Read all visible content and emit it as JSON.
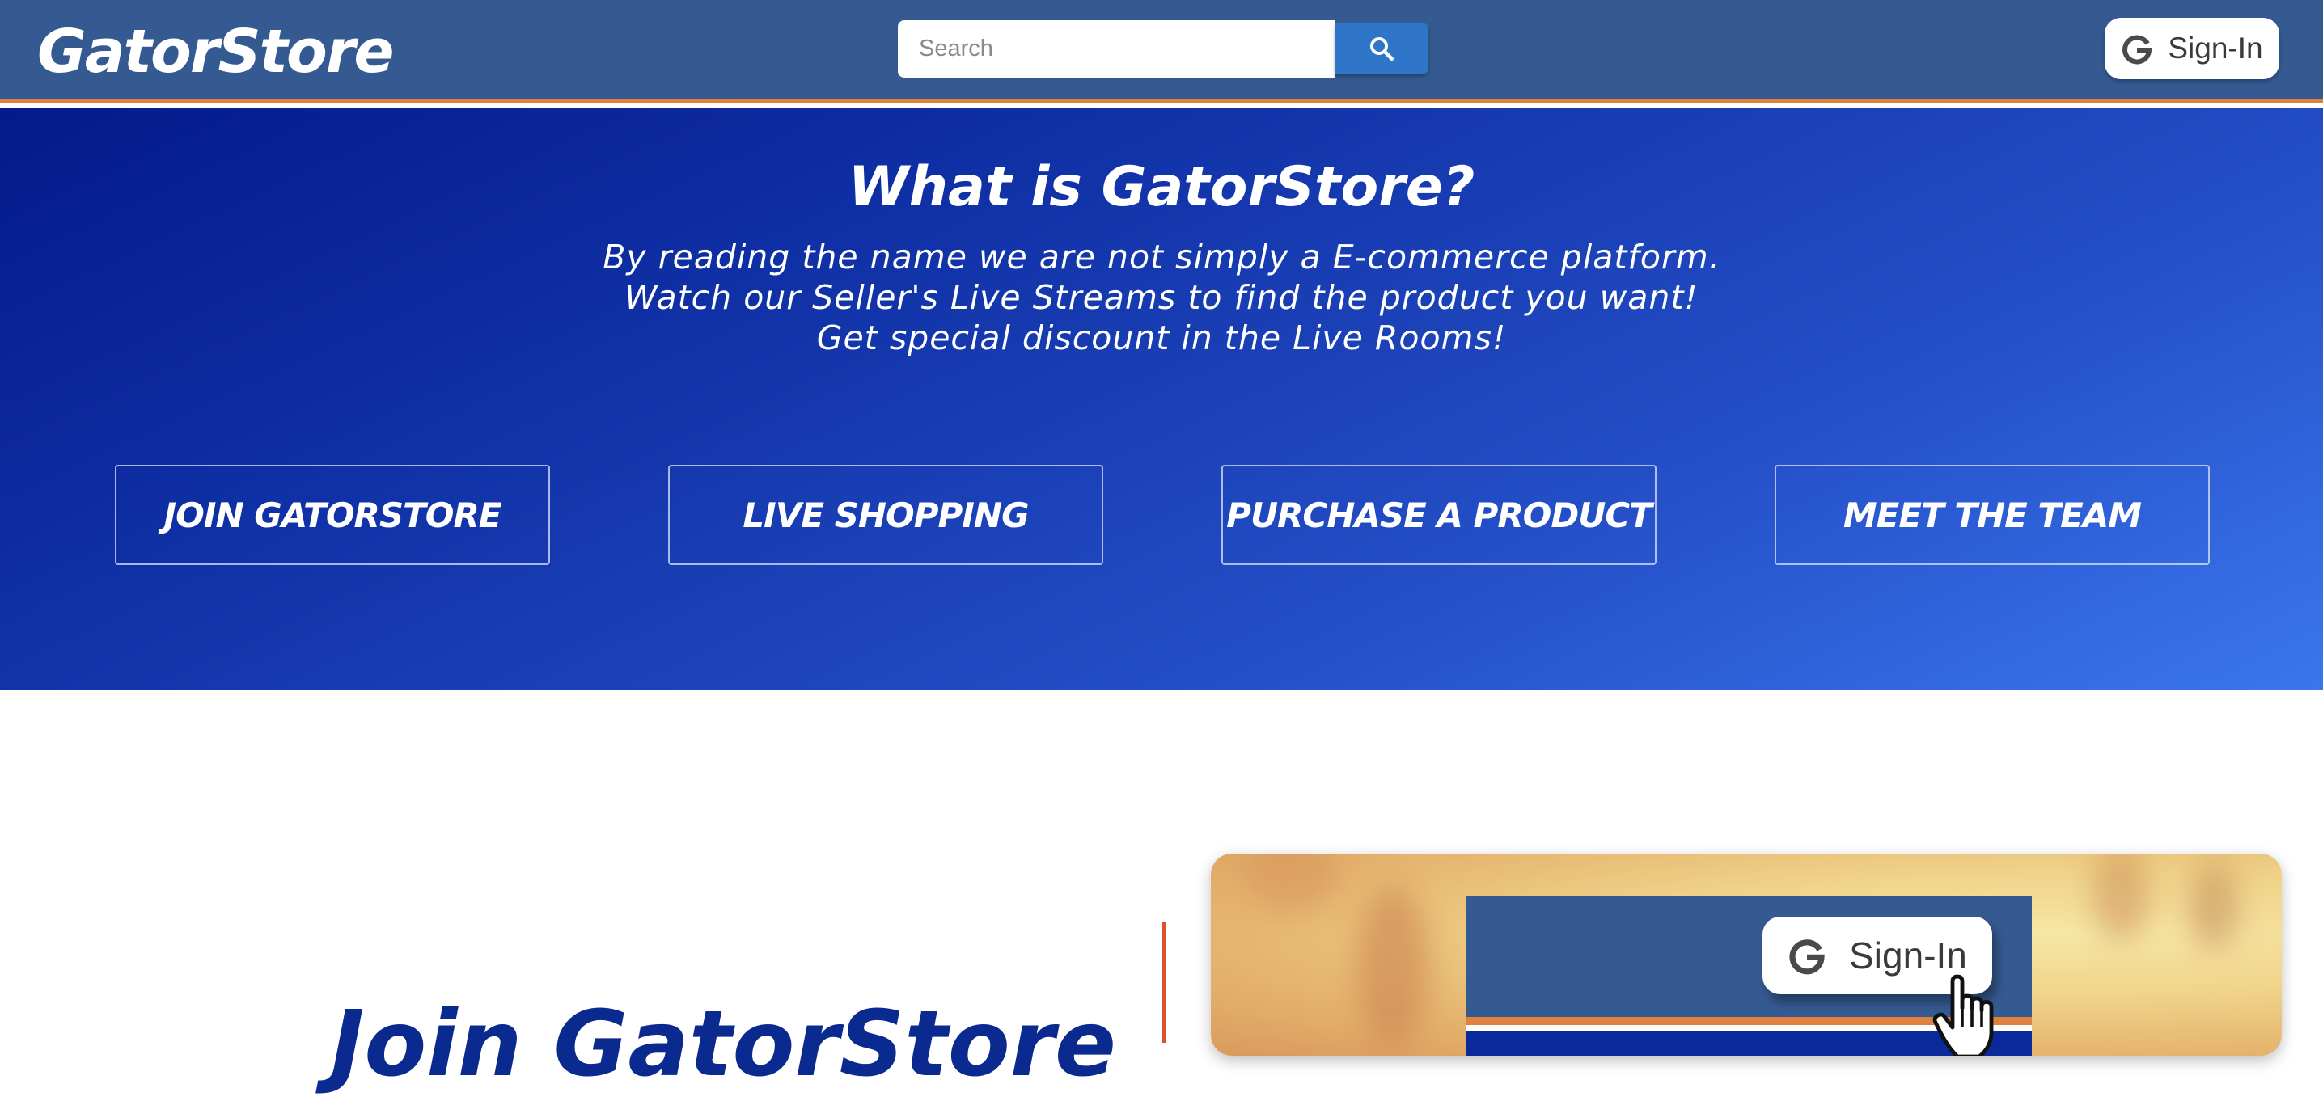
{
  "navbar": {
    "logo": "GatorStore",
    "search": {
      "placeholder": "Search",
      "value": "",
      "button_icon": "search-icon"
    },
    "signin": {
      "label": "Sign-In",
      "icon": "google-g-icon"
    },
    "colors": {
      "bar": "#355a92",
      "accent_stripe": "#e0823d",
      "search_button": "#2f76c9"
    }
  },
  "hero": {
    "title": "What is GatorStore?",
    "lines": [
      "By reading the name we are not simply a E-commerce platform.",
      "Watch our Seller's Live Streams to find the product you want!",
      "Get special discount in the Live Rooms!"
    ],
    "buttons": [
      {
        "label": "JOIN GATORSTORE"
      },
      {
        "label": "LIVE SHOPPING"
      },
      {
        "label": "PURCHASE A PRODUCT"
      },
      {
        "label": "MEET THE TEAM"
      }
    ],
    "colors": {
      "gradient_start": "#041a8a",
      "gradient_end": "#3a76ee"
    }
  },
  "section": {
    "title": "Join GatorStore",
    "divider_color": "#d9532e",
    "preview": {
      "signin_label": "Sign-In",
      "signin_icon": "google-g-icon",
      "cursor_icon": "hand-pointer-icon"
    }
  }
}
